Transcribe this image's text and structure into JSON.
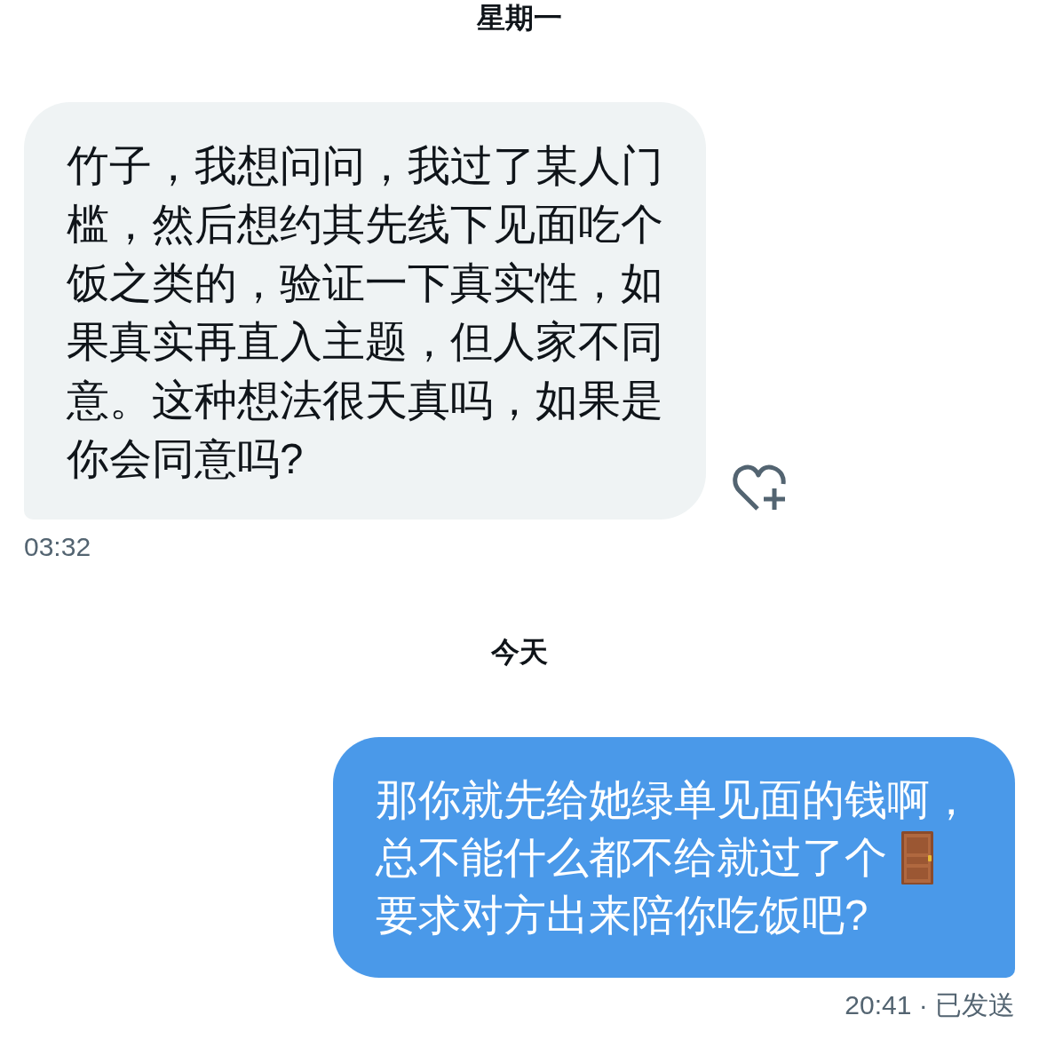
{
  "sections": [
    {
      "day": "星期一",
      "messages": [
        {
          "kind": "incoming",
          "lines": [
            [
              {
                "kind": "text",
                "text": "竹子，我想问问，我过了某人门槛，然后想约其先线下见面吃个饭之类的，验证一下真实性，如果真实再直入主题，但人家不同意。这种想法很天真吗，如果是你会同意吗?"
              }
            ]
          ],
          "meta": "03:32"
        }
      ]
    },
    {
      "day": "今天",
      "messages": [
        {
          "kind": "outgoing",
          "lines": [
            [
              {
                "kind": "text",
                "text": "那你就先给她绿单见面的钱啊，"
              }
            ],
            [
              {
                "kind": "text",
                "text": "总不能什么都不给就过了个"
              },
              {
                "kind": "emoji"
              }
            ],
            [
              {
                "kind": "text",
                "text": "要求对方出来陪你吃饭吧?"
              }
            ]
          ],
          "meta": "20:41 · 已发送"
        }
      ]
    }
  ]
}
